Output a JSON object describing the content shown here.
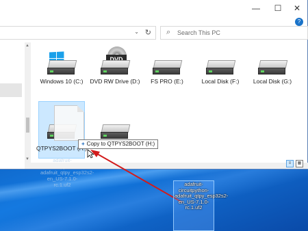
{
  "window": {
    "controls": {
      "minimize": "—",
      "maximize": "☐",
      "close": "✕"
    },
    "address": {
      "dropdown_glyph": "⌄",
      "refresh_glyph": "↻"
    },
    "search": {
      "placeholder": "Search This PC",
      "icon": "search-icon"
    },
    "help_glyph": "?"
  },
  "drives": [
    {
      "label": "Windows 10 (C:)",
      "icon": "windows-drive-icon"
    },
    {
      "label": "DVD RW Drive (D:)",
      "icon": "dvd-drive-icon",
      "badge": "DVD"
    },
    {
      "label": "FS PRO (E:)",
      "icon": "hard-drive-icon"
    },
    {
      "label": "Local Disk (F:)",
      "icon": "hard-drive-icon"
    },
    {
      "label": "Local Disk (G:)",
      "icon": "hard-drive-icon"
    },
    {
      "label": "QTPYS2BOOT (H:)",
      "icon": "hard-drive-icon",
      "selected": true
    },
    {
      "label": "",
      "icon": "hard-drive-icon"
    }
  ],
  "drag": {
    "tooltip": "Copy to QTPYS2BOOT (H:)",
    "tooltip_icon": "plus-icon",
    "ghost_filename": "adafruit-circuitpython-adafruit_qtpy_esp32s2-en_US-7.1.0-rc.1.uf2"
  },
  "desktop": {
    "file_label": "adafruit-circuitpython-adafruit_qtpy_esp32s2-en_US-7.1.0-rc.1.uf2",
    "file_icon": "uf2-file-icon"
  },
  "colors": {
    "selection": "#cce8ff",
    "arrow": "#d21b1b",
    "desktop": "#0f66c8"
  }
}
